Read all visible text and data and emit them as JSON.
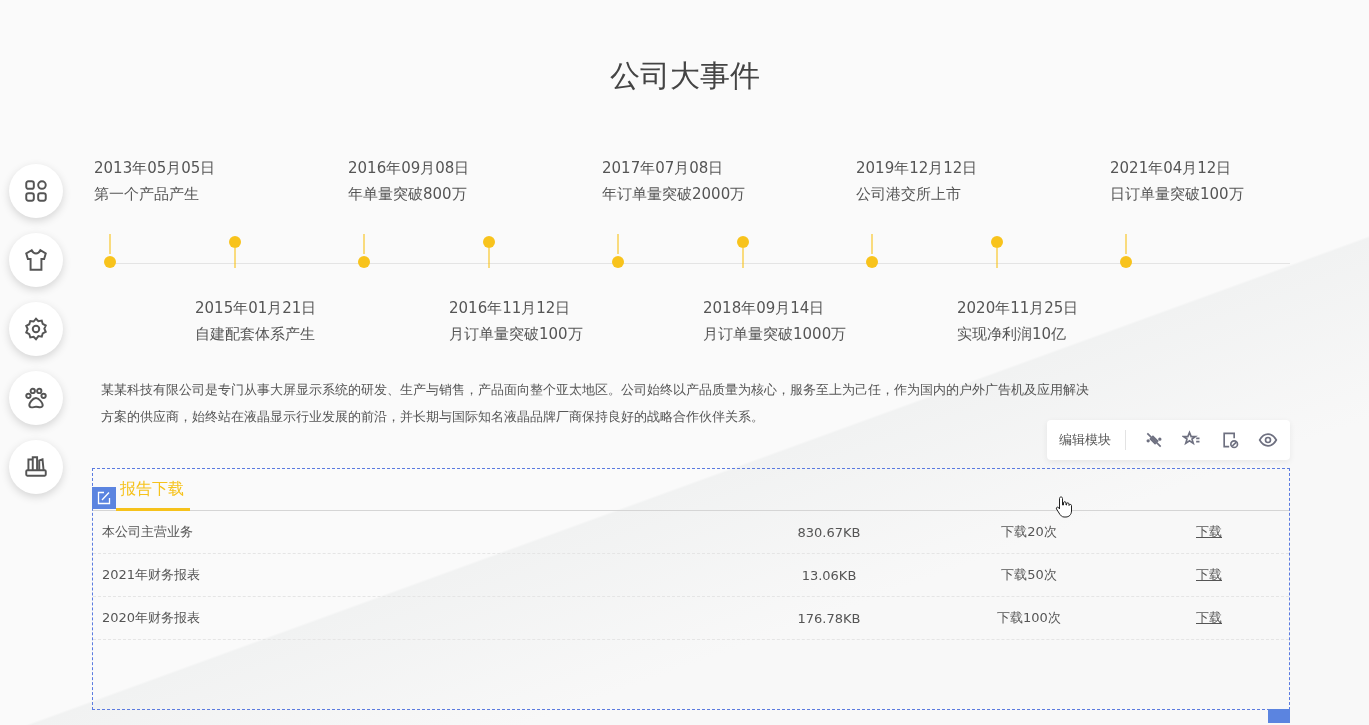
{
  "title": "公司大事件",
  "timeline": [
    {
      "date": "2013年05月05日",
      "event": "第一个产品产生"
    },
    {
      "date": "2015年01月21日",
      "event": "自建配套体系产生"
    },
    {
      "date": "2016年09月08日",
      "event": "年单量突破800万"
    },
    {
      "date": "2016年11月12日",
      "event": "月订单量突破100万"
    },
    {
      "date": "2017年07月08日",
      "event": "年订单量突破2000万"
    },
    {
      "date": "2018年09月14日",
      "event": "月订单量突破1000万"
    },
    {
      "date": "2019年12月12日",
      "event": "公司港交所上市"
    },
    {
      "date": "2020年11月25日",
      "event": "实现净利润10亿"
    },
    {
      "date": "2021年04月12日",
      "event": "日订单量突破100万"
    }
  ],
  "intro": "某某科技有限公司是专门从事大屏显示系统的研发、生产与销售，产品面向整个亚太地区。公司始终以产品质量为核心，服务至上为己任，作为国内的户外广告机及应用解决方案的供应商，始终站在液晶显示行业发展的前沿，并长期与国际知名液晶品牌厂商保持良好的战略合作伙伴关系。",
  "toolbar": {
    "label": "编辑模块"
  },
  "downloads": {
    "tabs": [
      {
        "label": "报告下载",
        "selected": true
      }
    ],
    "rows": [
      {
        "name": "本公司主营业务",
        "size": "830.67KB",
        "count": "下载20次",
        "link": "下载"
      },
      {
        "name": "2021年财务报表",
        "size": "13.06KB",
        "count": "下载50次",
        "link": "下载"
      },
      {
        "name": "2020年财务报表",
        "size": "176.78KB",
        "count": "下载100次",
        "link": "下载"
      }
    ]
  }
}
